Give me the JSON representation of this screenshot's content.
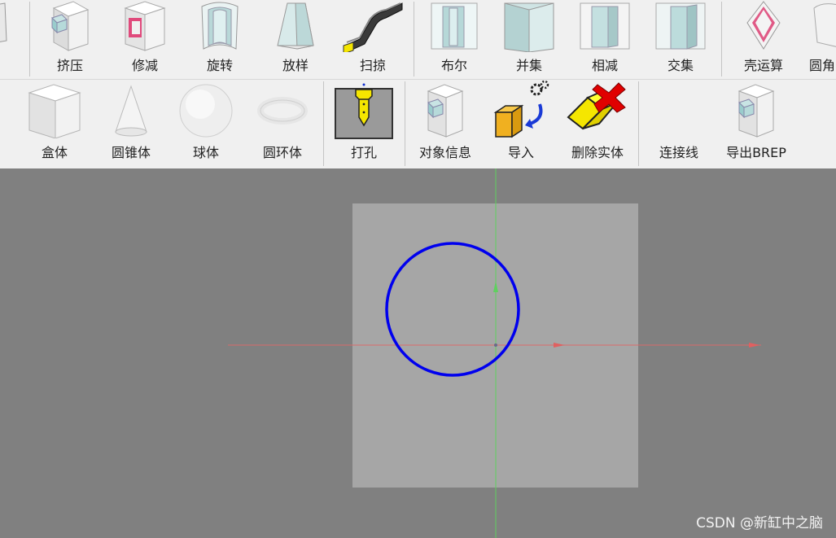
{
  "toolbar": {
    "row1": [
      {
        "label": "",
        "icon": "partial-shape-icon"
      },
      {
        "label": "挤压",
        "icon": "extrude-icon"
      },
      {
        "label": "修减",
        "icon": "trim-icon"
      },
      {
        "label": "旋转",
        "icon": "revolve-icon"
      },
      {
        "label": "放样",
        "icon": "loft-icon"
      },
      {
        "label": "扫掠",
        "icon": "sweep-icon"
      },
      {
        "label": "布尔",
        "icon": "boolean-icon"
      },
      {
        "label": "并集",
        "icon": "union-icon"
      },
      {
        "label": "相减",
        "icon": "subtract-icon"
      },
      {
        "label": "交集",
        "icon": "intersect-icon"
      },
      {
        "label": "壳运算",
        "icon": "shell-icon"
      },
      {
        "label": "圆角",
        "icon": "fillet-icon"
      }
    ],
    "row2": [
      {
        "label": "",
        "icon": "partial-shape-icon"
      },
      {
        "label": "盒体",
        "icon": "box-icon"
      },
      {
        "label": "圆锥体",
        "icon": "cone-icon"
      },
      {
        "label": "球体",
        "icon": "sphere-icon"
      },
      {
        "label": "圆环体",
        "icon": "torus-icon"
      },
      {
        "label": "打孔",
        "icon": "drill-hole-icon"
      },
      {
        "label": "对象信息",
        "icon": "object-info-icon"
      },
      {
        "label": "导入",
        "icon": "import-icon"
      },
      {
        "label": "删除实体",
        "icon": "delete-solid-icon"
      },
      {
        "label": "连接线",
        "icon": "connect-line-icon"
      },
      {
        "label": "导出BREP",
        "icon": "export-brep-icon"
      }
    ]
  },
  "viewport": {
    "background": "#808080",
    "sheet_color": "#a6a6a6",
    "circle_color": "#0000ee",
    "x_axis_color": "#d96a6a",
    "y_axis_color": "#5fd05f"
  },
  "watermark": "CSDN @新缸中之脑"
}
